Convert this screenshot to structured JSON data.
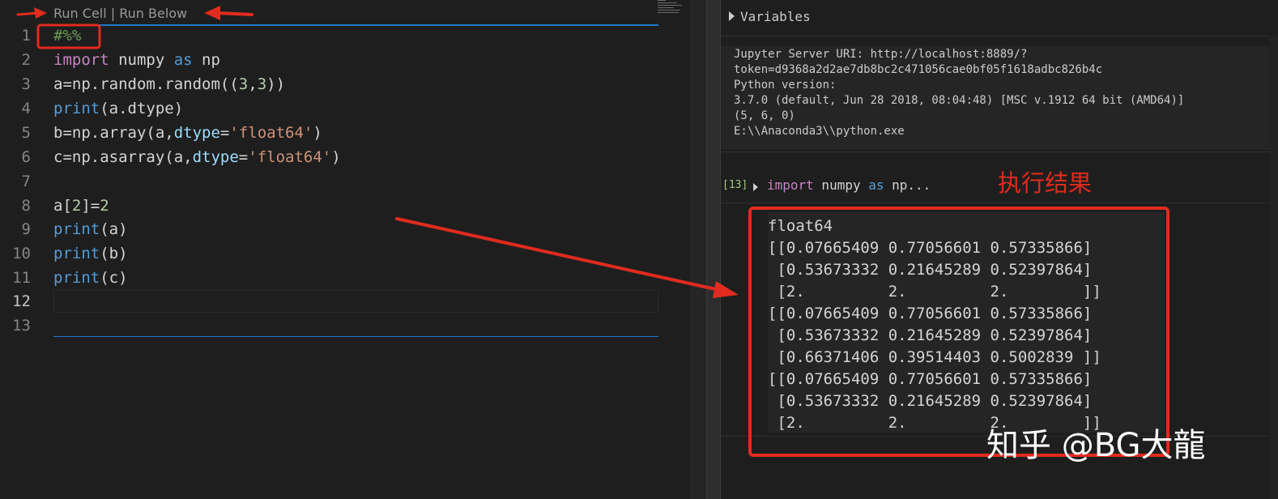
{
  "editor": {
    "codelens": {
      "run_cell": "Run Cell",
      "separator": " | ",
      "run_below": "Run Below"
    },
    "line_numbers": [
      "1",
      "2",
      "3",
      "4",
      "5",
      "6",
      "7",
      "8",
      "9",
      "10",
      "11",
      "12",
      "13"
    ],
    "lines": {
      "l1": {
        "comment": "#%%"
      },
      "l2": {
        "kw_import": "import",
        "module": " numpy ",
        "kw_as": "as",
        "alias": " np"
      },
      "l3": {
        "head": "a=np.random.random((",
        "n1": "3",
        "comma": ",",
        "n2": "3",
        "tail": "))"
      },
      "l4": {
        "fn": "print",
        "rest": "(a.dtype)"
      },
      "l5": {
        "head": "b=np.array(a,",
        "param": "dtype",
        "eq": "=",
        "str": "'float64'",
        "tail": ")"
      },
      "l6": {
        "head": "c=np.asarray(a,",
        "param": "dtype",
        "eq": "=",
        "str": "'float64'",
        "tail": ")"
      },
      "l8": {
        "head": "a[",
        "idx": "2",
        "mid": "]=",
        "val": "2"
      },
      "l9": {
        "fn": "print",
        "rest": "(a)"
      },
      "l10": {
        "fn": "print",
        "rest": "(b)"
      },
      "l11": {
        "fn": "print",
        "rest": "(c)"
      }
    }
  },
  "interactive": {
    "variables_label": "Variables",
    "sysinfo": [
      "Jupyter Server URI: http://localhost:8889/?",
      "token=d9368a2d2ae7db8bc2c471056cae0bf05f1618adbc826b4c",
      "Python version:",
      "3.7.0 (default, Jun 28 2018, 08:04:48) [MSC v.1912 64 bit (AMD64)]",
      "(5, 6, 0)",
      "E:\\\\Anaconda3\\\\python.exe"
    ],
    "exec_count": "[13]",
    "exec_code": {
      "kw_import": "import",
      "module": " numpy ",
      "kw_as": "as",
      "rest": " np..."
    },
    "output": [
      "float64",
      "[[0.07665409 0.77056601 0.57335866]",
      " [0.53673332 0.21645289 0.52397864]",
      " [2.         2.         2.        ]]",
      "[[0.07665409 0.77056601 0.57335866]",
      " [0.53673332 0.21645289 0.52397864]",
      " [0.66371406 0.39514403 0.5002839 ]]",
      "[[0.07665409 0.77056601 0.57335866]",
      " [0.53673332 0.21645289 0.52397864]",
      " [2.         2.         2.        ]]"
    ]
  },
  "annotation": {
    "label": "执行结果",
    "color": "#e02b1e"
  },
  "watermark": "知乎 @BG大龍",
  "colors": {
    "background": "#1e1e1e",
    "cell_divider": "#1f77c8",
    "comment": "#6a9955",
    "keyword": "#c586c0",
    "function": "#569cd6",
    "string": "#ce9178",
    "number": "#b5cea8"
  }
}
